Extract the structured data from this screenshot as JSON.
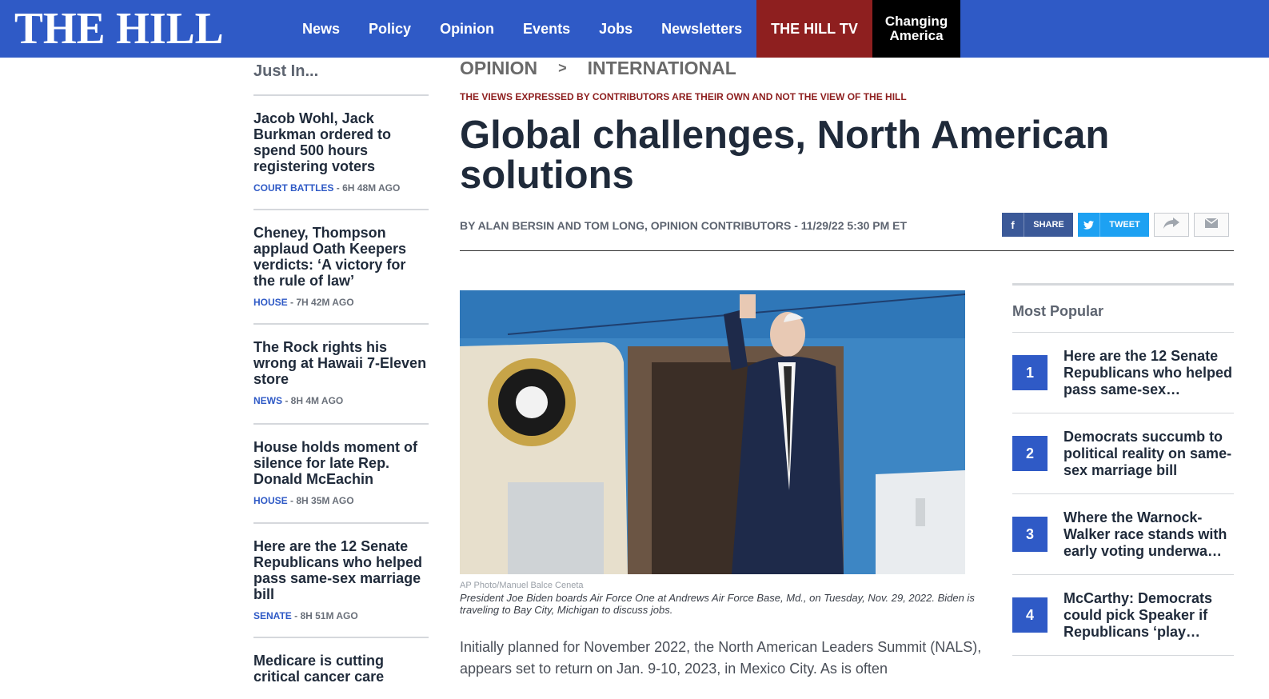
{
  "header": {
    "logo": "THE HILL",
    "nav": [
      "News",
      "Policy",
      "Opinion",
      "Events",
      "Jobs",
      "Newsletters"
    ],
    "tv_label": "THE HILL TV",
    "changing_line1": "Changing",
    "changing_line2": "America"
  },
  "sidebar": {
    "title": "Just In...",
    "items": [
      {
        "title": "Jacob Wohl, Jack Burkman ordered to spend 500 hours registering voters",
        "category": "COURT BATTLES",
        "time": " - 6H 48M AGO"
      },
      {
        "title": "Cheney, Thompson applaud Oath Keepers verdicts: ‘A victory for the rule of law’",
        "category": "HOUSE",
        "time": " - 7H 42M AGO"
      },
      {
        "title": "The Rock rights his wrong at Hawaii 7-Eleven store",
        "category": "NEWS",
        "time": " - 8H 4M AGO"
      },
      {
        "title": "House holds moment of silence for late Rep. Donald McEachin",
        "category": "HOUSE",
        "time": " - 8H 35M AGO"
      },
      {
        "title": "Here are the 12 Senate Republicans who helped pass same-sex marriage bill",
        "category": "SENATE",
        "time": " - 8H 51M AGO"
      },
      {
        "title": "Medicare is cutting critical cancer care",
        "category": "",
        "time": ""
      }
    ]
  },
  "article": {
    "section": "OPINION",
    "separator": ">",
    "subsection": "INTERNATIONAL",
    "disclaimer": "THE VIEWS EXPRESSED BY CONTRIBUTORS ARE THEIR OWN AND NOT THE VIEW OF THE HILL",
    "headline": "Global challenges, North American solutions",
    "byline": "BY ALAN BERSIN AND TOM LONG, OPINION CONTRIBUTORS - 11/29/22 5:30 PM ET",
    "share_label": "SHARE",
    "tweet_label": "TWEET",
    "photo_credit": "AP Photo/Manuel Balce Ceneta",
    "caption": "President Joe Biden boards Air Force One at Andrews Air Force Base, Md., on Tuesday, Nov. 29, 2022. Biden is traveling to Bay City, Michigan to discuss jobs.",
    "body": "Initially planned for November 2022, the North American Leaders Summit (NALS), appears set to return on Jan. 9-10, 2023, in Mexico City. As is often"
  },
  "popular": {
    "title": "Most Popular",
    "items": [
      {
        "num": "1",
        "title": "Here are the 12 Senate Republicans who helped pass same-sex…"
      },
      {
        "num": "2",
        "title": "Democrats succumb to political reality on same-sex marriage bill"
      },
      {
        "num": "3",
        "title": "Where the Warnock-Walker race stands with early voting underwa…"
      },
      {
        "num": "4",
        "title": "McCarthy: Democrats could pick Speaker if Republicans ‘play…"
      }
    ]
  },
  "colors": {
    "brand": "#2f5ac6",
    "tv": "#8e1f1f",
    "disclaimer": "#8e1f1f"
  }
}
